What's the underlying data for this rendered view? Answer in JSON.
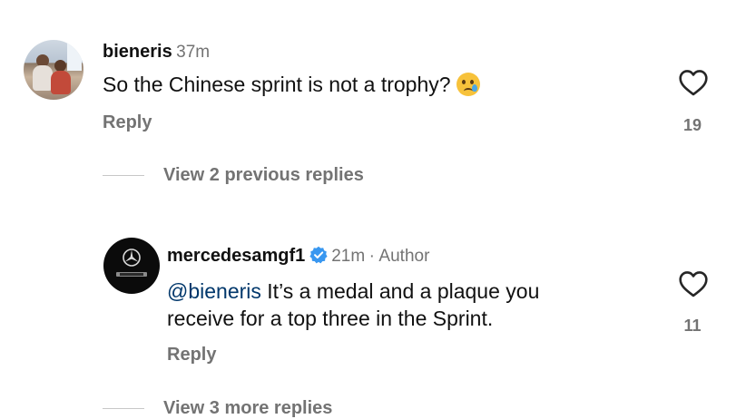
{
  "comment": {
    "username": "bieneris",
    "time": "37m",
    "text": "So the Chinese sprint is not a trophy?",
    "emoji_icon": "crying-face-icon",
    "reply_label": "Reply",
    "likes": "19"
  },
  "view_previous": "View 2 previous replies",
  "reply": {
    "username": "mercedesamgf1",
    "verified_icon": "verified-badge-icon",
    "time": "21m",
    "separator": "·",
    "author_label": "Author",
    "mention": "@bieneris",
    "text_line1": " It’s a medal and a plaque you",
    "text_line2": "receive for a top three in the Sprint.",
    "reply_label": "Reply",
    "likes": "11",
    "avatar_logo_text": "AMG"
  },
  "view_more": "View 3 more replies",
  "colors": {
    "primary_text": "#111111",
    "secondary_text": "#737373",
    "mention": "#00376b",
    "verified_blue": "#3897f0"
  }
}
